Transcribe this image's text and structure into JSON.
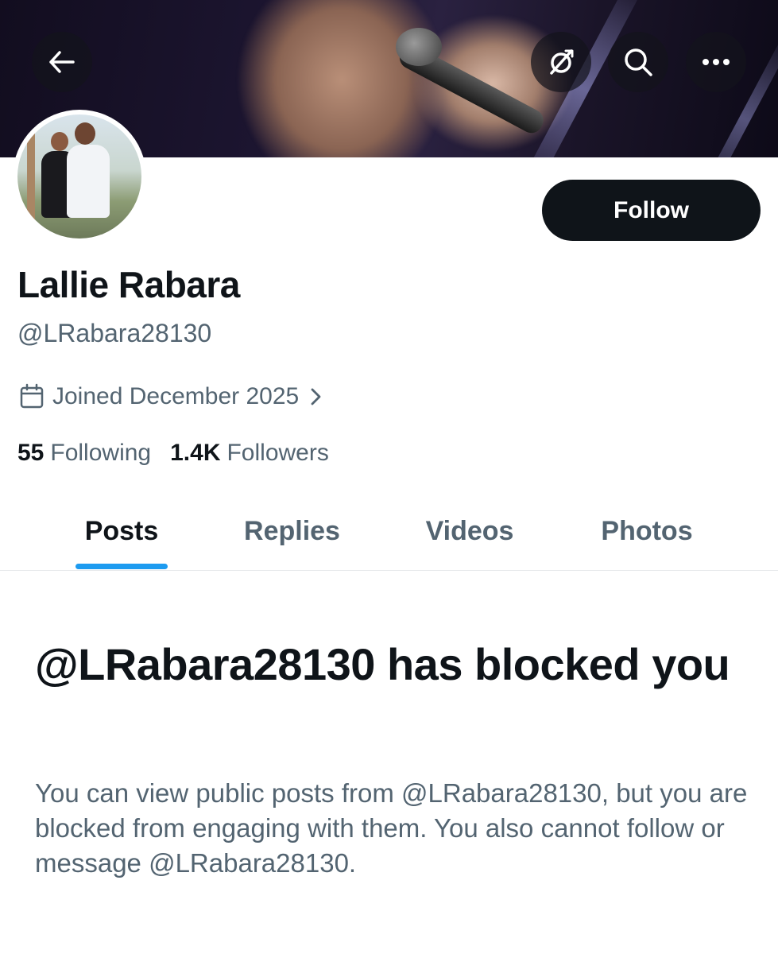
{
  "profile": {
    "display_name": "Lallie Rabara",
    "handle": "@LRabara28130",
    "joined": "Joined December 2025",
    "following_count": "55",
    "following_label": "Following",
    "followers_count": "1.4K",
    "followers_label": "Followers"
  },
  "header": {
    "icons": [
      "back-arrow-icon",
      "translate-icon",
      "search-icon",
      "more-icon"
    ]
  },
  "actions": {
    "follow_label": "Follow"
  },
  "tabs": [
    {
      "label": "Posts",
      "active": true
    },
    {
      "label": "Replies",
      "active": false
    },
    {
      "label": "Videos",
      "active": false
    },
    {
      "label": "Photos",
      "active": false
    }
  ],
  "blocked_notice": {
    "title": "@LRabara28130 has blocked you",
    "description": "You can view public posts from @LRabara28130, but you are blocked from engaging with them. You also cannot follow or message @LRabara28130."
  },
  "colors": {
    "accent": "#1d9bf0",
    "text_primary": "#0f1419",
    "text_secondary": "#536471",
    "follow_button_bg": "#0f1419"
  }
}
